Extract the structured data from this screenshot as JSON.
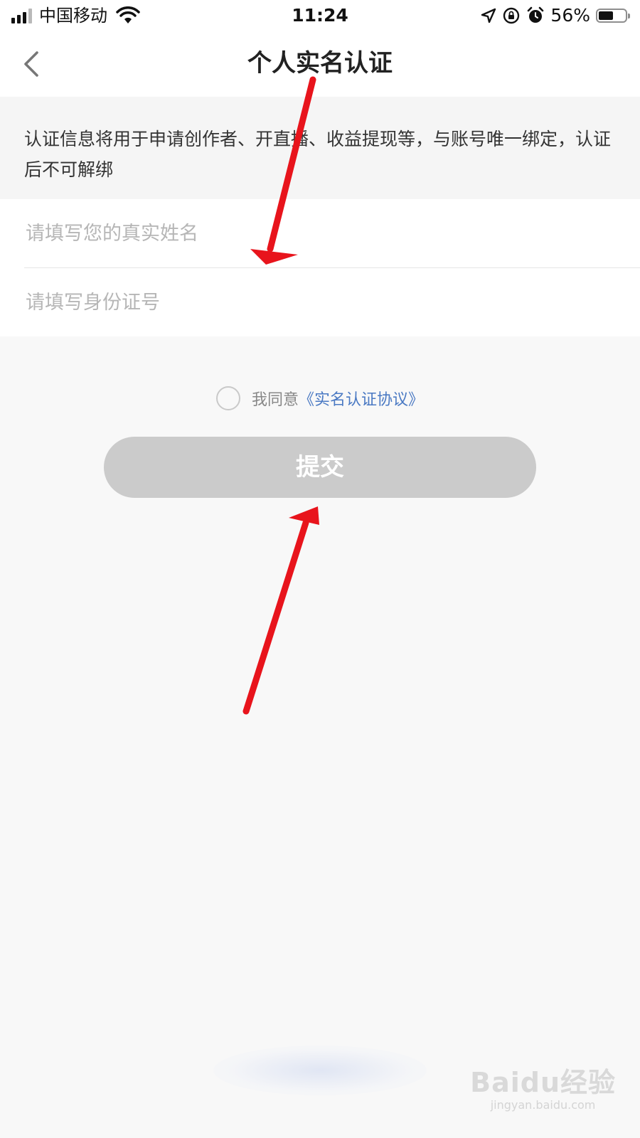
{
  "status_bar": {
    "carrier": "中国移动",
    "time": "11:24",
    "battery": "56%",
    "battery_level": 0.56
  },
  "nav": {
    "title": "个人实名认证",
    "back_icon": "chevron-left-icon"
  },
  "notice": {
    "text": "认证信息将用于申请创作者、开直播、收益提现等，与账号唯一绑定，认证后不可解绑"
  },
  "form": {
    "name_placeholder": "请填写您的真实姓名",
    "name_value": "",
    "id_placeholder": "请填写身份证号",
    "id_value": ""
  },
  "agreement": {
    "prefix": "我同意",
    "link": "《实名认证协议》",
    "checked": false
  },
  "submit": {
    "label": "提交"
  },
  "colors": {
    "link": "#4a79c3",
    "button_disabled": "#cbcbcb",
    "arrow": "#e8141c"
  },
  "watermark": {
    "logo": "Baidu经验",
    "url": "jingyan.baidu.com"
  }
}
